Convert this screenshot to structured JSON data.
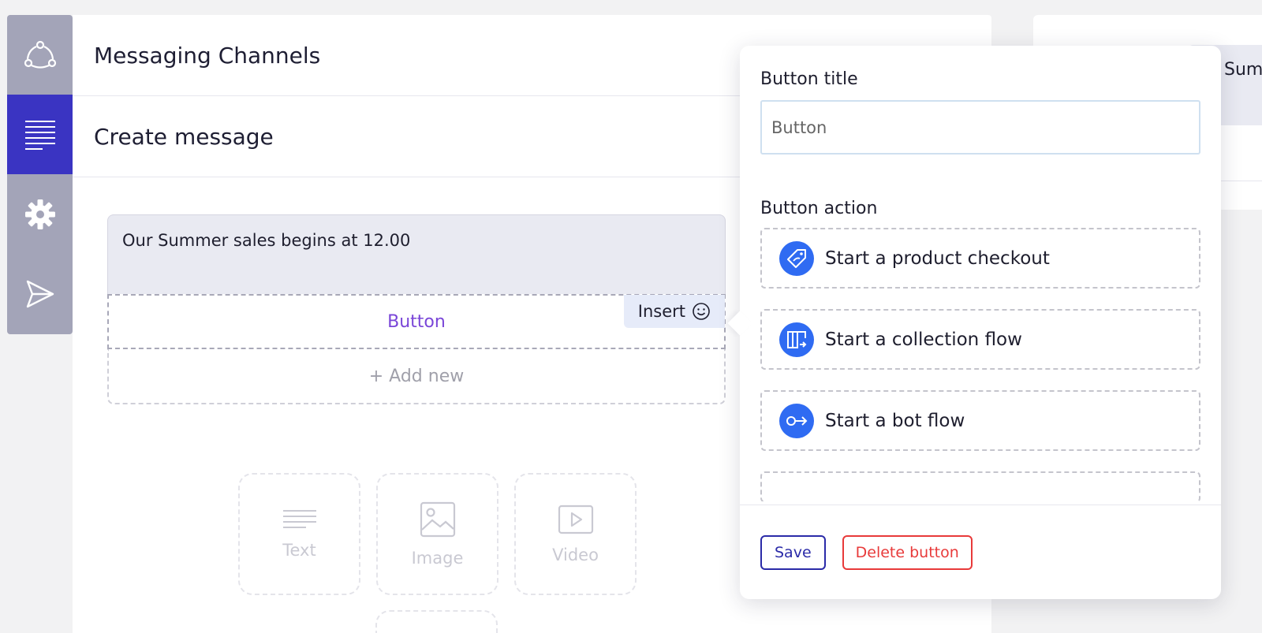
{
  "sidebar": {
    "items": [
      {
        "icon": "network-icon",
        "active": false
      },
      {
        "icon": "lines-icon",
        "active": true
      },
      {
        "icon": "gear-icon",
        "active": false
      },
      {
        "icon": "send-icon",
        "active": false
      }
    ]
  },
  "header": {
    "title": "Messaging Channels",
    "subtitle": "Create message"
  },
  "editor": {
    "message_text": "Our Summer sales begins at 12.00",
    "button_label": "Button",
    "insert_label": "Insert",
    "add_new_label": "+ Add new",
    "tiles": [
      {
        "label": "Text",
        "icon": "text-icon"
      },
      {
        "label": "Image",
        "icon": "image-icon"
      },
      {
        "label": "Video",
        "icon": "video-icon"
      }
    ]
  },
  "background_card": {
    "text": "Sum"
  },
  "panel": {
    "title_label": "Button title",
    "title_value": "Button",
    "action_label": "Button action",
    "actions": [
      {
        "label": "Start a product checkout",
        "icon": "price-tag-icon"
      },
      {
        "label": "Start a collection flow",
        "icon": "collection-icon"
      },
      {
        "label": "Start a bot flow",
        "icon": "bot-flow-icon"
      }
    ],
    "save_label": "Save",
    "delete_label": "Delete button"
  },
  "colors": {
    "accent": "#3a34c2",
    "action_icon": "#2f6bf2",
    "danger": "#e83a3a",
    "button_text": "#7a46d8"
  }
}
